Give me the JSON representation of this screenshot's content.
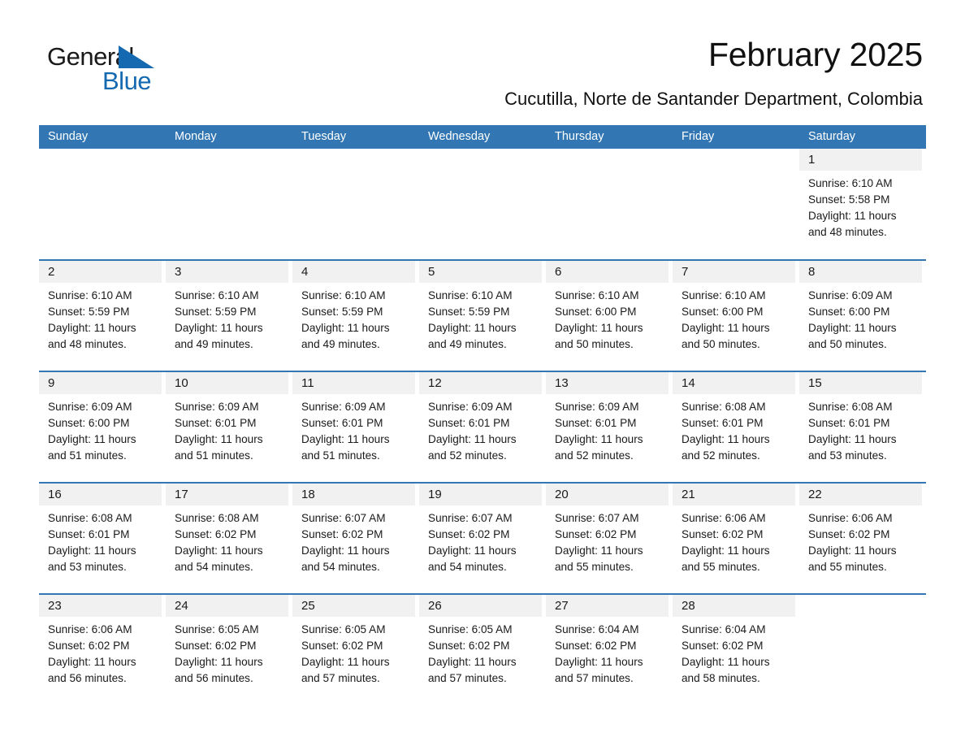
{
  "brand": {
    "word1": "General",
    "word2": "Blue",
    "logo_icon": "blue-triangle-icon",
    "accent_color": "#1569b0"
  },
  "header": {
    "title": "February 2025",
    "subtitle": "Cucutilla, Norte de Santander Department, Colombia"
  },
  "calendar": {
    "header_bg": "#3277b3",
    "day_band_bg": "#f1f1f1",
    "weekdays": [
      "Sunday",
      "Monday",
      "Tuesday",
      "Wednesday",
      "Thursday",
      "Friday",
      "Saturday"
    ],
    "weeks": [
      [
        {
          "day": "",
          "sunrise": "",
          "sunset": "",
          "daylight1": "",
          "daylight2": ""
        },
        {
          "day": "",
          "sunrise": "",
          "sunset": "",
          "daylight1": "",
          "daylight2": ""
        },
        {
          "day": "",
          "sunrise": "",
          "sunset": "",
          "daylight1": "",
          "daylight2": ""
        },
        {
          "day": "",
          "sunrise": "",
          "sunset": "",
          "daylight1": "",
          "daylight2": ""
        },
        {
          "day": "",
          "sunrise": "",
          "sunset": "",
          "daylight1": "",
          "daylight2": ""
        },
        {
          "day": "",
          "sunrise": "",
          "sunset": "",
          "daylight1": "",
          "daylight2": ""
        },
        {
          "day": "1",
          "sunrise": "Sunrise: 6:10 AM",
          "sunset": "Sunset: 5:58 PM",
          "daylight1": "Daylight: 11 hours",
          "daylight2": "and 48 minutes."
        }
      ],
      [
        {
          "day": "2",
          "sunrise": "Sunrise: 6:10 AM",
          "sunset": "Sunset: 5:59 PM",
          "daylight1": "Daylight: 11 hours",
          "daylight2": "and 48 minutes."
        },
        {
          "day": "3",
          "sunrise": "Sunrise: 6:10 AM",
          "sunset": "Sunset: 5:59 PM",
          "daylight1": "Daylight: 11 hours",
          "daylight2": "and 49 minutes."
        },
        {
          "day": "4",
          "sunrise": "Sunrise: 6:10 AM",
          "sunset": "Sunset: 5:59 PM",
          "daylight1": "Daylight: 11 hours",
          "daylight2": "and 49 minutes."
        },
        {
          "day": "5",
          "sunrise": "Sunrise: 6:10 AM",
          "sunset": "Sunset: 5:59 PM",
          "daylight1": "Daylight: 11 hours",
          "daylight2": "and 49 minutes."
        },
        {
          "day": "6",
          "sunrise": "Sunrise: 6:10 AM",
          "sunset": "Sunset: 6:00 PM",
          "daylight1": "Daylight: 11 hours",
          "daylight2": "and 50 minutes."
        },
        {
          "day": "7",
          "sunrise": "Sunrise: 6:10 AM",
          "sunset": "Sunset: 6:00 PM",
          "daylight1": "Daylight: 11 hours",
          "daylight2": "and 50 minutes."
        },
        {
          "day": "8",
          "sunrise": "Sunrise: 6:09 AM",
          "sunset": "Sunset: 6:00 PM",
          "daylight1": "Daylight: 11 hours",
          "daylight2": "and 50 minutes."
        }
      ],
      [
        {
          "day": "9",
          "sunrise": "Sunrise: 6:09 AM",
          "sunset": "Sunset: 6:00 PM",
          "daylight1": "Daylight: 11 hours",
          "daylight2": "and 51 minutes."
        },
        {
          "day": "10",
          "sunrise": "Sunrise: 6:09 AM",
          "sunset": "Sunset: 6:01 PM",
          "daylight1": "Daylight: 11 hours",
          "daylight2": "and 51 minutes."
        },
        {
          "day": "11",
          "sunrise": "Sunrise: 6:09 AM",
          "sunset": "Sunset: 6:01 PM",
          "daylight1": "Daylight: 11 hours",
          "daylight2": "and 51 minutes."
        },
        {
          "day": "12",
          "sunrise": "Sunrise: 6:09 AM",
          "sunset": "Sunset: 6:01 PM",
          "daylight1": "Daylight: 11 hours",
          "daylight2": "and 52 minutes."
        },
        {
          "day": "13",
          "sunrise": "Sunrise: 6:09 AM",
          "sunset": "Sunset: 6:01 PM",
          "daylight1": "Daylight: 11 hours",
          "daylight2": "and 52 minutes."
        },
        {
          "day": "14",
          "sunrise": "Sunrise: 6:08 AM",
          "sunset": "Sunset: 6:01 PM",
          "daylight1": "Daylight: 11 hours",
          "daylight2": "and 52 minutes."
        },
        {
          "day": "15",
          "sunrise": "Sunrise: 6:08 AM",
          "sunset": "Sunset: 6:01 PM",
          "daylight1": "Daylight: 11 hours",
          "daylight2": "and 53 minutes."
        }
      ],
      [
        {
          "day": "16",
          "sunrise": "Sunrise: 6:08 AM",
          "sunset": "Sunset: 6:01 PM",
          "daylight1": "Daylight: 11 hours",
          "daylight2": "and 53 minutes."
        },
        {
          "day": "17",
          "sunrise": "Sunrise: 6:08 AM",
          "sunset": "Sunset: 6:02 PM",
          "daylight1": "Daylight: 11 hours",
          "daylight2": "and 54 minutes."
        },
        {
          "day": "18",
          "sunrise": "Sunrise: 6:07 AM",
          "sunset": "Sunset: 6:02 PM",
          "daylight1": "Daylight: 11 hours",
          "daylight2": "and 54 minutes."
        },
        {
          "day": "19",
          "sunrise": "Sunrise: 6:07 AM",
          "sunset": "Sunset: 6:02 PM",
          "daylight1": "Daylight: 11 hours",
          "daylight2": "and 54 minutes."
        },
        {
          "day": "20",
          "sunrise": "Sunrise: 6:07 AM",
          "sunset": "Sunset: 6:02 PM",
          "daylight1": "Daylight: 11 hours",
          "daylight2": "and 55 minutes."
        },
        {
          "day": "21",
          "sunrise": "Sunrise: 6:06 AM",
          "sunset": "Sunset: 6:02 PM",
          "daylight1": "Daylight: 11 hours",
          "daylight2": "and 55 minutes."
        },
        {
          "day": "22",
          "sunrise": "Sunrise: 6:06 AM",
          "sunset": "Sunset: 6:02 PM",
          "daylight1": "Daylight: 11 hours",
          "daylight2": "and 55 minutes."
        }
      ],
      [
        {
          "day": "23",
          "sunrise": "Sunrise: 6:06 AM",
          "sunset": "Sunset: 6:02 PM",
          "daylight1": "Daylight: 11 hours",
          "daylight2": "and 56 minutes."
        },
        {
          "day": "24",
          "sunrise": "Sunrise: 6:05 AM",
          "sunset": "Sunset: 6:02 PM",
          "daylight1": "Daylight: 11 hours",
          "daylight2": "and 56 minutes."
        },
        {
          "day": "25",
          "sunrise": "Sunrise: 6:05 AM",
          "sunset": "Sunset: 6:02 PM",
          "daylight1": "Daylight: 11 hours",
          "daylight2": "and 57 minutes."
        },
        {
          "day": "26",
          "sunrise": "Sunrise: 6:05 AM",
          "sunset": "Sunset: 6:02 PM",
          "daylight1": "Daylight: 11 hours",
          "daylight2": "and 57 minutes."
        },
        {
          "day": "27",
          "sunrise": "Sunrise: 6:04 AM",
          "sunset": "Sunset: 6:02 PM",
          "daylight1": "Daylight: 11 hours",
          "daylight2": "and 57 minutes."
        },
        {
          "day": "28",
          "sunrise": "Sunrise: 6:04 AM",
          "sunset": "Sunset: 6:02 PM",
          "daylight1": "Daylight: 11 hours",
          "daylight2": "and 58 minutes."
        },
        {
          "day": "",
          "sunrise": "",
          "sunset": "",
          "daylight1": "",
          "daylight2": ""
        }
      ]
    ]
  }
}
